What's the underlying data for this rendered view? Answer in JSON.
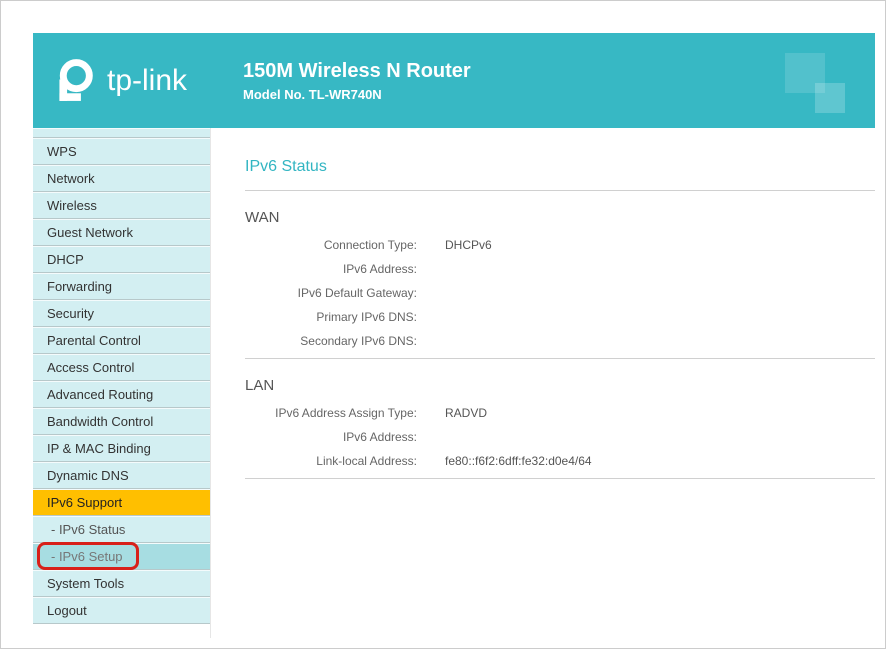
{
  "header": {
    "brand": "tp-link",
    "title": "150M Wireless N Router",
    "model": "Model No. TL-WR740N"
  },
  "sidebar": {
    "items": [
      {
        "label": "",
        "type": "truncated"
      },
      {
        "label": "WPS",
        "type": "item"
      },
      {
        "label": "Network",
        "type": "item"
      },
      {
        "label": "Wireless",
        "type": "item"
      },
      {
        "label": "Guest Network",
        "type": "item"
      },
      {
        "label": "DHCP",
        "type": "item"
      },
      {
        "label": "Forwarding",
        "type": "item"
      },
      {
        "label": "Security",
        "type": "item"
      },
      {
        "label": "Parental Control",
        "type": "item"
      },
      {
        "label": "Access Control",
        "type": "item"
      },
      {
        "label": "Advanced Routing",
        "type": "item"
      },
      {
        "label": "Bandwidth Control",
        "type": "item"
      },
      {
        "label": "IP & MAC Binding",
        "type": "item"
      },
      {
        "label": "Dynamic DNS",
        "type": "item"
      },
      {
        "label": "IPv6 Support",
        "type": "parent-active"
      },
      {
        "label": "- IPv6 Status",
        "type": "sub"
      },
      {
        "label": "- IPv6 Setup",
        "type": "sub current highlighted"
      },
      {
        "label": "System Tools",
        "type": "item"
      },
      {
        "label": "Logout",
        "type": "item"
      }
    ]
  },
  "content": {
    "page_title": "IPv6 Status",
    "wan": {
      "heading": "WAN",
      "rows": [
        {
          "label": "Connection Type:",
          "value": "DHCPv6"
        },
        {
          "label": "IPv6 Address:",
          "value": ""
        },
        {
          "label": "IPv6 Default Gateway:",
          "value": ""
        },
        {
          "label": "Primary IPv6 DNS:",
          "value": ""
        },
        {
          "label": "Secondary IPv6 DNS:",
          "value": ""
        }
      ]
    },
    "lan": {
      "heading": "LAN",
      "rows": [
        {
          "label": "IPv6 Address Assign Type:",
          "value": "RADVD"
        },
        {
          "label": "IPv6 Address:",
          "value": ""
        },
        {
          "label": "Link-local Address:",
          "value": "fe80::f6f2:6dff:fe32:d0e4/64"
        }
      ]
    }
  }
}
